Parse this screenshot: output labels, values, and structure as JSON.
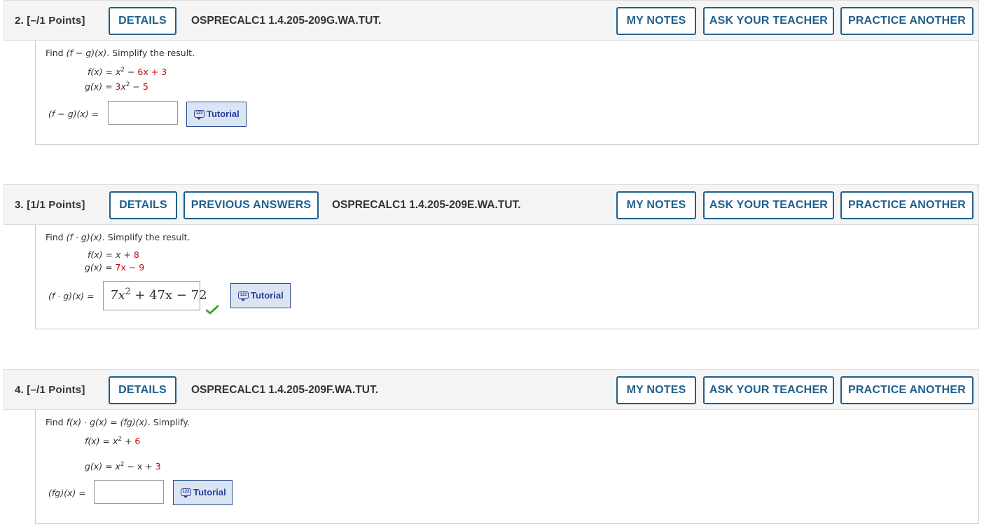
{
  "questions": [
    {
      "number_label": "2. [–/1 Points]",
      "buttons": {
        "details": "DETAILS",
        "my_notes": "MY NOTES",
        "ask_teacher": "ASK YOUR TEACHER",
        "practice": "PRACTICE ANOTHER"
      },
      "code": "OSPRECALC1 1.4.205-209G.WA.TUT.",
      "prompt": {
        "find": "Find ",
        "expr": "(f − g)(x)",
        "tail": ". Simplify the result."
      },
      "f_label": "f(x)",
      "f_eq": " = ",
      "f_var": "x",
      "f_exp": "2",
      "f_rest": " − ",
      "f_red": "6x + 3",
      "g_label": "g(x)",
      "g_eq": " = ",
      "g_coef": "3",
      "g_var": "x",
      "g_exp": "2",
      "g_rest": " − ",
      "g_red": "5",
      "answer_label": "(f − g)(x) =",
      "answer_value": "",
      "tutorial": "Tutorial"
    },
    {
      "number_label": "3. [1/1 Points]",
      "buttons": {
        "details": "DETAILS",
        "previous": "PREVIOUS ANSWERS",
        "my_notes": "MY NOTES",
        "ask_teacher": "ASK YOUR TEACHER",
        "practice": "PRACTICE ANOTHER"
      },
      "code": "OSPRECALC1 1.4.205-209E.WA.TUT.",
      "prompt": {
        "find": "Find ",
        "expr": "(f · g)(x)",
        "tail": ". Simplify the result."
      },
      "f_label": "f(x)",
      "f_eq": " = ",
      "f_var": "x",
      "f_rest": " + ",
      "f_red": "8",
      "g_label": "g(x)",
      "g_eq": " = ",
      "g_red": "7x − 9",
      "answer_label": "(f · g)(x) =",
      "answer_value": {
        "a": "7x",
        "exp": "2",
        "b": " + 47x − 72"
      },
      "tutorial": "Tutorial",
      "status": "correct-checkmark"
    },
    {
      "number_label": "4. [–/1 Points]",
      "buttons": {
        "details": "DETAILS",
        "my_notes": "MY NOTES",
        "ask_teacher": "ASK YOUR TEACHER",
        "practice": "PRACTICE ANOTHER"
      },
      "code": "OSPRECALC1 1.4.205-209F.WA.TUT.",
      "prompt": {
        "find": "Find ",
        "expr": "f(x) · g(x) = (fg)(x)",
        "tail": ". Simplify."
      },
      "f_label": "f(x)",
      "f_eq": " = ",
      "f_var": "x",
      "f_exp": "2",
      "f_rest": " + ",
      "f_red": "6",
      "g_label": "g(x)",
      "g_eq": " = ",
      "g_var": "x",
      "g_exp": "2",
      "g_rest": " − x + ",
      "g_red": "3",
      "answer_label": "(fg)(x) =",
      "answer_value": "",
      "tutorial": "Tutorial"
    }
  ],
  "colors": {
    "button_border": "#1f5f8b",
    "given_value": "#cc0000",
    "tutorial_bg": "#dbe4f2",
    "check": "#3aa832"
  }
}
